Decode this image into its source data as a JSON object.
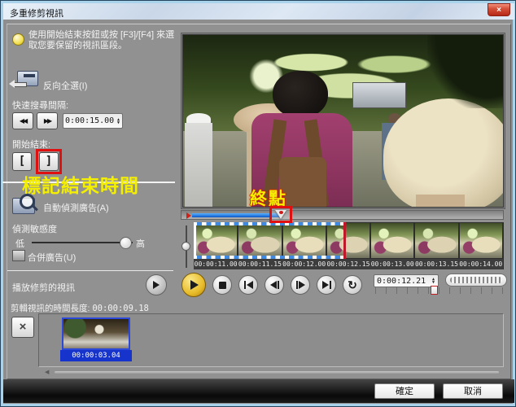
{
  "window": {
    "title": "多重修剪視訊"
  },
  "instruction": "使用開始結束按鈕或按 [F3]/[F4] 來選取您要保留的視訊區段。",
  "controls": {
    "invert_select": "反向全選(I)",
    "quick_search_label": "快速搜尋間隔:",
    "quick_search_value": "0:00:15.00",
    "start_end_label": "開始結束:",
    "mark_start_glyph": "[",
    "mark_end_glyph": "]",
    "auto_detect": "自動偵測廣告(A)",
    "sensitivity_label": "偵測敏感度",
    "sensitivity_low": "低",
    "sensitivity_high": "高",
    "merge_ads": "合併廣告(U)",
    "play_trimmed": "播放修剪的視訊",
    "duration_label": "剪輯視訊的時間長度:",
    "duration_value": "00:00:09.18"
  },
  "annotations": {
    "mark_end_time": "標記結束時間",
    "end_point": "終點"
  },
  "timeline": {
    "frames": [
      "00:00:11.00",
      "00:00:11.15",
      "00:00:12.00",
      "00:00:12.15",
      "00:00:13.00",
      "00:00:13.15",
      "00:00:14.00"
    ]
  },
  "transport": {
    "timecode": "0:00:12.21"
  },
  "clip_tray": {
    "clip_time": "00:00:03.04"
  },
  "footer": {
    "ok": "確定",
    "cancel": "取消"
  },
  "icons": {
    "close": "×",
    "rewind": "◀◀",
    "forward": "▶▶",
    "repeat": "↻",
    "delete": "×",
    "scroll_left": "◀",
    "spin_up": "▲",
    "spin_down": "▼"
  },
  "colors": {
    "annotation_red": "#e01010",
    "annotation_yellow": "#f4ef00",
    "selection_blue": "#2f7fe0",
    "progress_blue": "#1d7de8",
    "clip_label_blue": "#1633cc",
    "play_button_yellow": "#e8bc2a",
    "titlebar_blue": "#c9d7e8"
  }
}
